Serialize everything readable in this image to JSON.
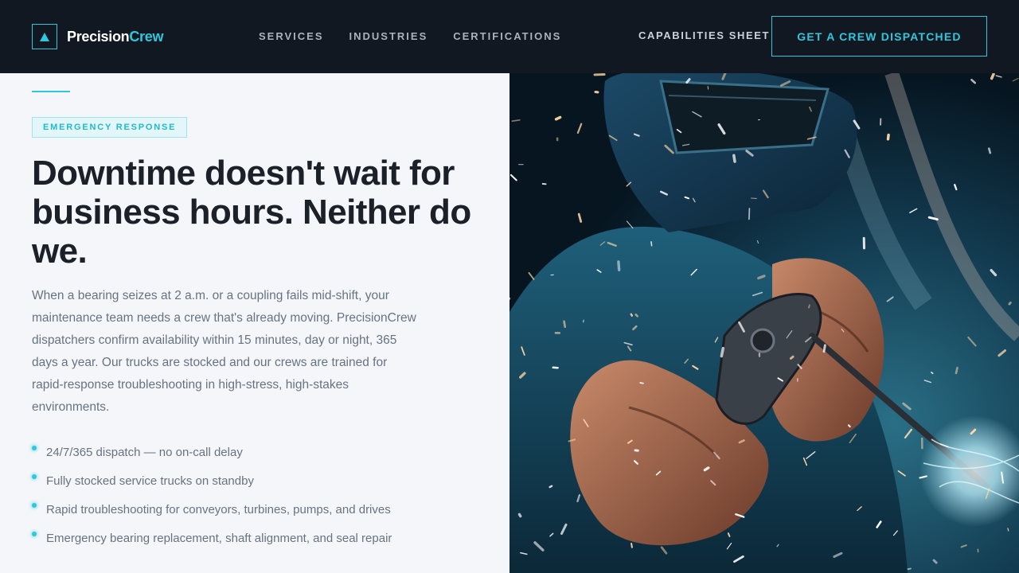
{
  "brand": {
    "name_main": "Precision",
    "name_accent": "Crew",
    "logo_icon": "triangle-icon",
    "accent_color": "#2ec8dc"
  },
  "nav": {
    "items": [
      {
        "label": "SERVICES"
      },
      {
        "label": "INDUSTRIES"
      },
      {
        "label": "CERTIFICATIONS"
      }
    ],
    "capabilities_label": "CAPABILITIES SHEET",
    "cta_label": "GET A CREW DISPATCHED"
  },
  "hero": {
    "badge": "EMERGENCY RESPONSE",
    "headline": "Downtime doesn't wait for business hours. Neither do we.",
    "body": "When a bearing seizes at 2 a.m. or a coupling fails mid-shift, your maintenance team needs a crew that's already moving. PrecisionCrew dispatchers confirm availability within 15 minutes, day or night, 365 days a year. Our trucks are stocked and our crews are trained for rapid-response troubleshooting in high-stress, high-stakes environments.",
    "features": [
      "24/7/365 dispatch — no on-call delay",
      "Fully stocked service trucks on standby",
      "Rapid troubleshooting for conveyors, turbines, pumps, and drives",
      "Emergency bearing replacement, shaft alignment, and seal repair"
    ],
    "image_subject": "welder-photo"
  }
}
